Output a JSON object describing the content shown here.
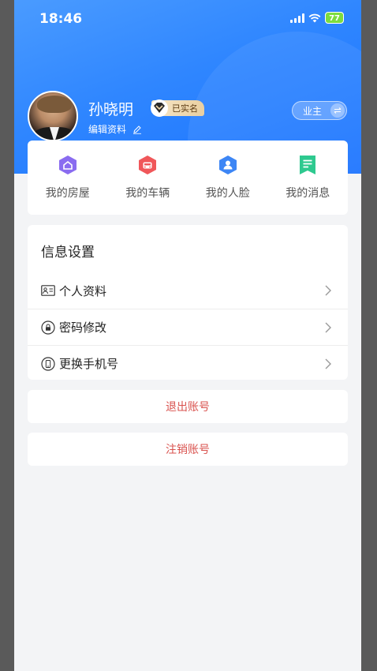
{
  "status_bar": {
    "time": "18:46",
    "battery": "77"
  },
  "profile": {
    "name": "孙晓明",
    "verified_badge": "已实名",
    "edit_link": "编辑资料",
    "role": "业主"
  },
  "quick_actions": [
    {
      "label": "我的房屋",
      "icon": "house-icon",
      "color": "#8a6cf0"
    },
    {
      "label": "我的车辆",
      "icon": "car-icon",
      "color": "#f0575a"
    },
    {
      "label": "我的人脸",
      "icon": "face-icon",
      "color": "#3d86f5"
    },
    {
      "label": "我的消息",
      "icon": "message-icon",
      "color": "#2ec98f"
    }
  ],
  "settings": {
    "title": "信息设置",
    "items": [
      {
        "label": "个人资料",
        "icon": "id-card-icon"
      },
      {
        "label": "密码修改",
        "icon": "lock-icon"
      },
      {
        "label": "更换手机号",
        "icon": "phone-icon"
      }
    ]
  },
  "actions": {
    "logout": "退出账号",
    "delete_account": "注销账号",
    "color": "#d9534f"
  },
  "colors": {
    "brand_blue": "#2f86ff",
    "page_bg": "#f3f4f6"
  }
}
